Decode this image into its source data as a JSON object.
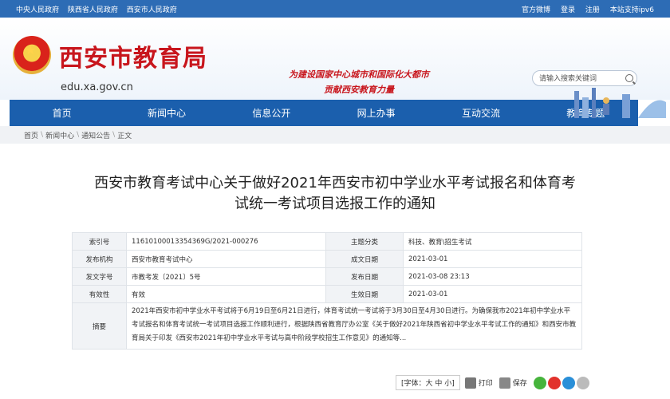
{
  "topbar": {
    "links": [
      "中央人民政府",
      "陕西省人民政府",
      "西安市人民政府"
    ],
    "right": [
      "官方微博",
      "登录",
      "注册",
      "本站支持ipv6"
    ]
  },
  "header": {
    "title": "西安市教育局",
    "domain": "edu.xa.gov.cn",
    "slogan_line1": "为建设国家中心城市和国际化大都市",
    "slogan_line2": "贡献西安教育力量",
    "search_placeholder": "请输入搜索关键词"
  },
  "nav": [
    "首页",
    "新闻中心",
    "信息公开",
    "网上办事",
    "互动交流",
    "教育专题"
  ],
  "breadcrumb": [
    "首页",
    "新闻中心",
    "通知公告",
    "正文"
  ],
  "article": {
    "title_line1": "西安市教育考试中心关于做好2021年西安市初中学业水平考试报名和体育考",
    "title_line2": "试统一考试项目选报工作的通知"
  },
  "meta": {
    "index_label": "索引号",
    "index_value": "11610100013354369G/2021-000276",
    "topic_label": "主题分类",
    "topic_value": "科技、教育\\招生考试",
    "org_label": "发布机构",
    "org_value": "西安市教育考试中心",
    "created_label": "成文日期",
    "created_value": "2021-03-01",
    "docno_label": "发文字号",
    "docno_value": "市教考发〔2021〕5号",
    "pub_label": "发布日期",
    "pub_value": "2021-03-08 23:13",
    "valid_label": "有效性",
    "valid_value": "有效",
    "effective_label": "生效日期",
    "effective_value": "2021-03-01",
    "summary_label": "摘要",
    "summary_value": "2021年西安市初中学业水平考试将于6月19日至6月21日进行，体育考试统一考试将于3月30日至4月30日进行。为确保我市2021年初中学业水平考试报名和体育考试统一考试项目选报工作顺利进行，根据陕西省教育厅办公室《关于做好2021年陕西省初中学业水平考试工作的通知》和西安市教育局关于印发《西安市2021年初中学业水平考试与高中阶段学校招生工作意见》的通知等..."
  },
  "tools": {
    "font": "[字体：大 中 小]",
    "print": "打印",
    "save": "保存"
  },
  "colors": {
    "primary": "#1b5fad",
    "topbar": "#2d6cb5",
    "title_red": "#c8161d"
  }
}
